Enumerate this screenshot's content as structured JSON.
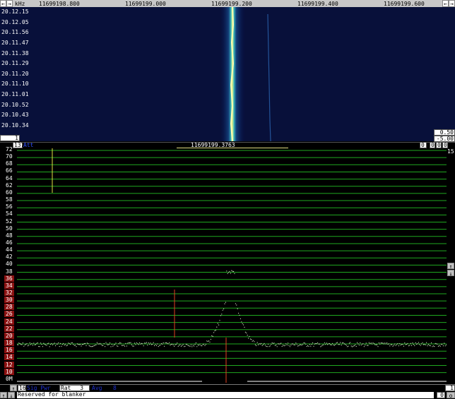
{
  "top_ruler": {
    "unit": "kHz",
    "freq_labels": [
      "11699198.800",
      "11699199.000",
      "11699199.200",
      "11699199.400",
      "11699199.600"
    ],
    "btn_left": "←",
    "btn_left2": "→",
    "btn_right_left": "←",
    "btn_right_right": "→"
  },
  "waterfall": {
    "times": [
      "20.12.15",
      "20.12.05",
      "20.11.56",
      "20.11.47",
      "20.11.38",
      "20.11.29",
      "20.11.20",
      "20.11.10",
      "20.11.01",
      "20.10.52",
      "20.10.43",
      "20.10.34"
    ],
    "bottom_left_value": "1",
    "right_values": [
      "0.50",
      "-5.00"
    ]
  },
  "spectrum_bar": {
    "left_value": "137",
    "left_tag": "Att",
    "center_freq": "11699199.3763",
    "right_values": [
      "0",
      "0",
      "0",
      "0"
    ],
    "right_corner": "15"
  },
  "spectrum": {
    "y_labels": [
      "72",
      "70",
      "68",
      "66",
      "64",
      "62",
      "60",
      "58",
      "56",
      "54",
      "52",
      "50",
      "48",
      "46",
      "44",
      "42",
      "40",
      "38",
      "36",
      "34",
      "32",
      "30",
      "28",
      "26",
      "24",
      "22",
      "20",
      "18",
      "16",
      "14",
      "12",
      "10",
      "0M"
    ],
    "red_labels": [
      "36",
      "34",
      "32",
      "30",
      "28",
      "26",
      "24",
      "22",
      "20",
      "18",
      "16",
      "14",
      "12",
      "10"
    ],
    "side_buttons": [
      "↑",
      "↓"
    ]
  },
  "status": {
    "row1": {
      "btn_up": "↑",
      "value": "16",
      "blue_tag": "Sig Pwr",
      "rat_label": "Rat",
      "rat_value": "3",
      "blue_tag2": "Avg",
      "blue_value2": "8",
      "right_value": "1"
    },
    "row2": {
      "btn_up": "↑",
      "btn_down": "↓",
      "message": "Reserved for blanker",
      "right_value": "0",
      "right_btn": "o"
    }
  }
}
